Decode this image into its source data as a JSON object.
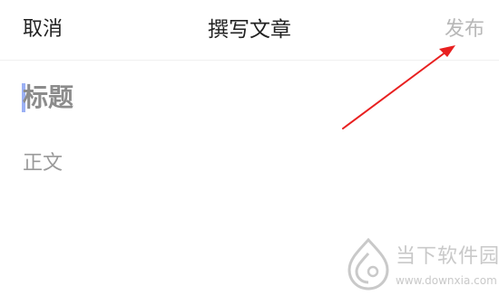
{
  "header": {
    "cancel_label": "取消",
    "title": "撰写文章",
    "publish_label": "发布"
  },
  "editor": {
    "title_placeholder": "标题",
    "body_placeholder": "正文"
  },
  "watermark": {
    "site_name": "当下软件园",
    "url": "www.downxia.com"
  },
  "colors": {
    "text_primary": "#222222",
    "text_disabled": "#b8b8b8",
    "placeholder_title": "#8c8c8c",
    "placeholder_body": "#9a9a9a",
    "caret": "#8aa2f2",
    "annotation_arrow": "#e82020",
    "watermark": "#c9c9c9"
  }
}
